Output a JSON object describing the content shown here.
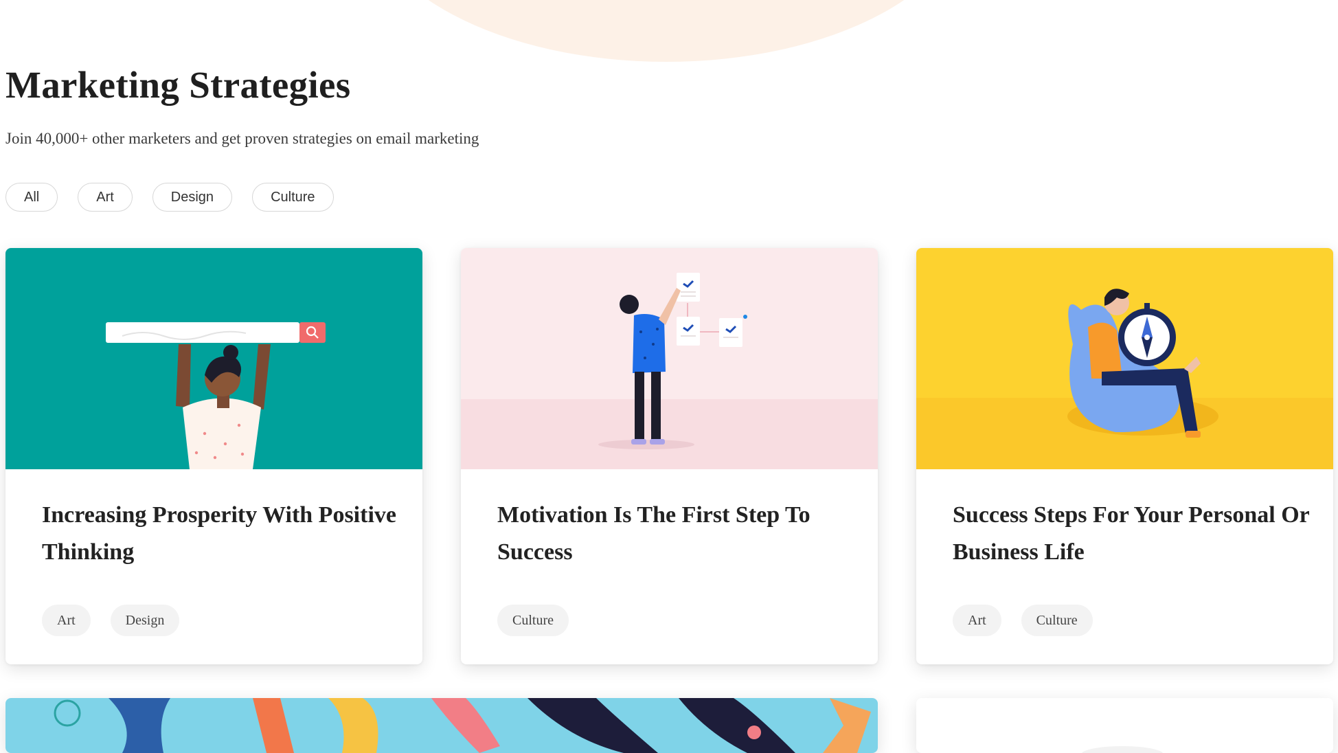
{
  "page": {
    "title": "Marketing Strategies",
    "subtitle": "Join 40,000+ other marketers and get proven strategies on email marketing"
  },
  "filters": [
    {
      "label": "All"
    },
    {
      "label": "Art"
    },
    {
      "label": "Design"
    },
    {
      "label": "Culture"
    }
  ],
  "cards": [
    {
      "title": "Increasing Prosperity With Positive Thinking",
      "image_bg": "#00a19b",
      "image_icon": "search-bar-illustration",
      "tags": [
        "Art",
        "Design"
      ]
    },
    {
      "title": "Motivation Is The First Step To Success",
      "image_bg": "#fbeaec",
      "image_icon": "motivation-board-illustration",
      "tags": [
        "Culture"
      ]
    },
    {
      "title": "Success Steps For Your Personal Or Business Life",
      "image_bg": "#fdd22f",
      "image_icon": "compass-illustration",
      "tags": [
        "Art",
        "Culture"
      ]
    }
  ],
  "colors": {
    "accent_teal": "#00a19b",
    "accent_pink": "#fbeaec",
    "accent_yellow": "#fdd22f",
    "search_red": "#f06b6b",
    "blob_peach": "#fdf1e7"
  }
}
